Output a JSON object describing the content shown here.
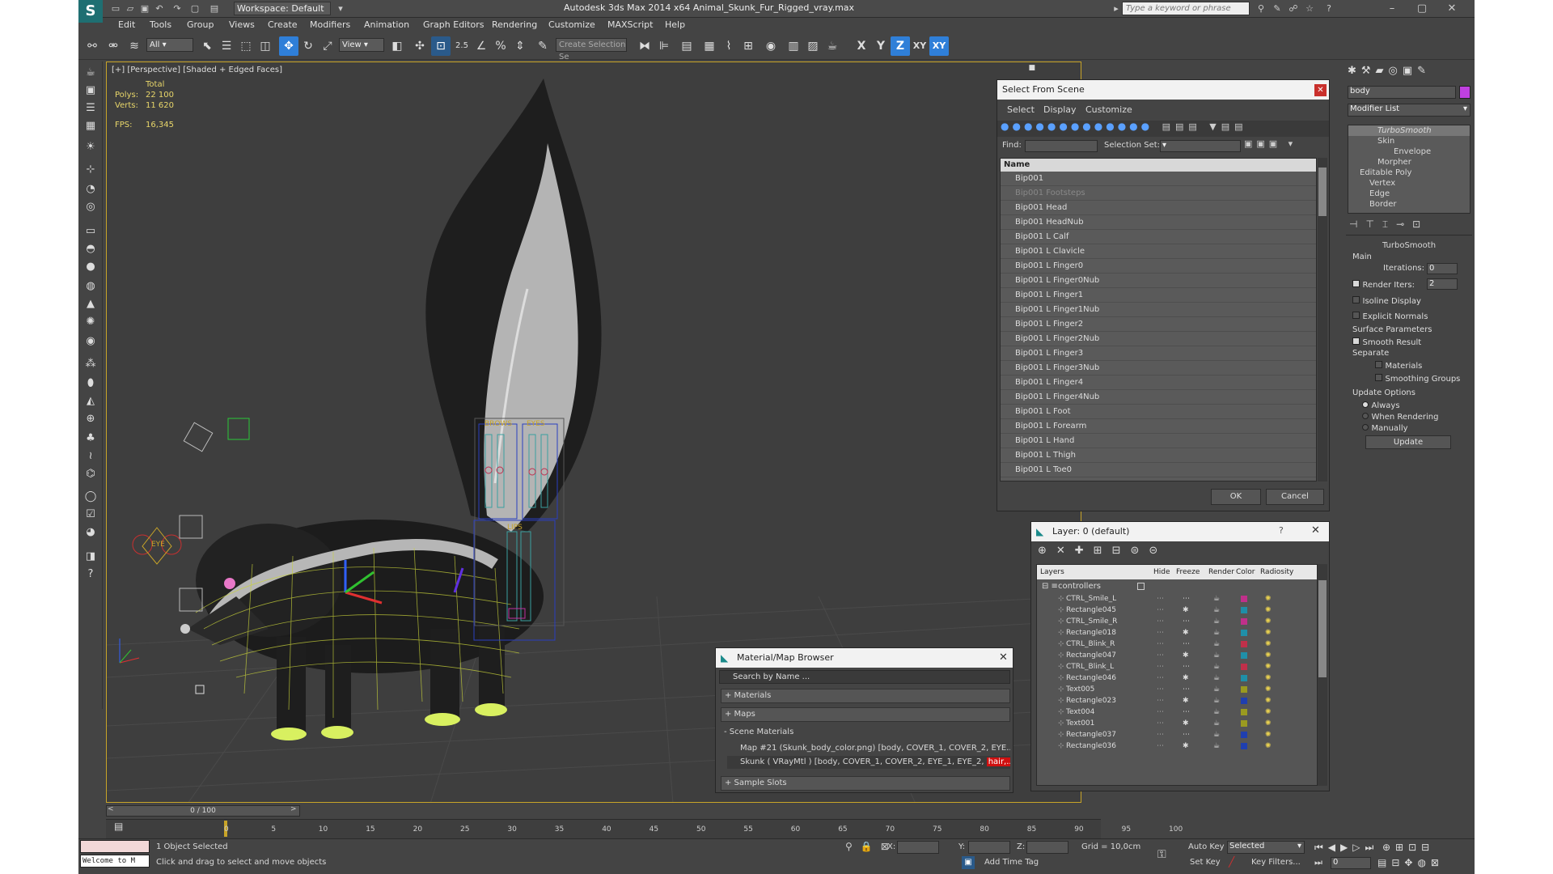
{
  "titlebar": {
    "workspace": "Workspace: Default",
    "app_title": "Autodesk 3ds Max  2014 x64     Animal_Skunk_Fur_Rigged_vray.max",
    "search_placeholder": "Type a keyword or phrase"
  },
  "menu": [
    "Edit",
    "Tools",
    "Group",
    "Views",
    "Create",
    "Modifiers",
    "Animation",
    "Graph Editors",
    "Rendering",
    "Customize",
    "MAXScript",
    "Help"
  ],
  "toolbar": {
    "filter": "All",
    "ref_coord": "View",
    "angle_snap": "2.5",
    "selection_set": "Create Selection Se",
    "axis": [
      "X",
      "Y",
      "Z",
      "XY",
      "XY"
    ]
  },
  "viewport": {
    "label": "[+] [Perspective] [Shaded + Edged Faces]",
    "stats": {
      "total_label": "Total",
      "polys_label": "Polys:",
      "polys": "22 100",
      "verts_label": "Verts:",
      "verts": "11 620",
      "fps_label": "FPS:",
      "fps": "16,345"
    },
    "rig_labels": {
      "brows": "BROWS",
      "eyes": "EYES",
      "lips": "LIPS",
      "eye": "EYE"
    }
  },
  "select_dialog": {
    "title": "Select From Scene",
    "menu": [
      "Select",
      "Display",
      "Customize"
    ],
    "find_label": "Find:",
    "selset_label": "Selection Set:",
    "column": "Name",
    "items": [
      "Bip001",
      "Bip001 Footsteps",
      "Bip001 Head",
      "Bip001 HeadNub",
      "Bip001 L Calf",
      "Bip001 L Clavicle",
      "Bip001 L Finger0",
      "Bip001 L Finger0Nub",
      "Bip001 L Finger1",
      "Bip001 L Finger1Nub",
      "Bip001 L Finger2",
      "Bip001 L Finger2Nub",
      "Bip001 L Finger3",
      "Bip001 L Finger3Nub",
      "Bip001 L Finger4",
      "Bip001 L Finger4Nub",
      "Bip001 L Foot",
      "Bip001 L Forearm",
      "Bip001 L Hand",
      "Bip001 L Thigh",
      "Bip001 L Toe0"
    ],
    "ok": "OK",
    "cancel": "Cancel"
  },
  "layer_dialog": {
    "title": "Layer: 0 (default)",
    "help": "?",
    "columns": [
      "Layers",
      "Hide",
      "Freeze",
      "Render",
      "Color",
      "Radiosity"
    ],
    "parent": "controllers",
    "rows": [
      {
        "name": "CTRL_Smile_L",
        "color": "#c0308a"
      },
      {
        "name": "Rectangle045",
        "color": "#1f8fa8"
      },
      {
        "name": "CTRL_Smile_R",
        "color": "#c0308a"
      },
      {
        "name": "Rectangle018",
        "color": "#1f8fa8"
      },
      {
        "name": "CTRL_Blink_R",
        "color": "#c0304a"
      },
      {
        "name": "Rectangle047",
        "color": "#1f8fa8"
      },
      {
        "name": "CTRL_Blink_L",
        "color": "#c0304a"
      },
      {
        "name": "Rectangle046",
        "color": "#1f8fa8"
      },
      {
        "name": "Text005",
        "color": "#9a9a20"
      },
      {
        "name": "Rectangle023",
        "color": "#1f3fb0"
      },
      {
        "name": "Text004",
        "color": "#9a9a20"
      },
      {
        "name": "Text001",
        "color": "#9a9a20"
      },
      {
        "name": "Rectangle037",
        "color": "#1f3fb0"
      },
      {
        "name": "Rectangle036",
        "color": "#1f3fb0"
      }
    ]
  },
  "material_browser": {
    "title": "Material/Map Browser",
    "search": "Search by Name ...",
    "sections": [
      "+ Materials",
      "+ Maps",
      "- Scene Materials"
    ],
    "map_item": "Map #21 (Skunk_body_color.png)  [body, COVER_1, COVER_2, EYE...",
    "mat_item": "Skunk  ( VRayMtl )  [body, COVER_1, COVER_2, EYE_1, EYE_2,",
    "mat_item_hl": "hair,...",
    "sample_slots": "+ Sample Slots"
  },
  "command_panel": {
    "object_name": "body",
    "modifier_list": "Modifier List",
    "stack": [
      "TurboSmooth",
      "Skin",
      "Envelope",
      "Morpher",
      "Editable Poly",
      "Vertex",
      "Edge",
      "Border"
    ],
    "rollout_title": "TurboSmooth",
    "main_label": "Main",
    "iterations_label": "Iterations:",
    "iterations": "0",
    "render_iters_label": "Render Iters:",
    "render_iters": "2",
    "isoline": "Isoline Display",
    "explicit_normals": "Explicit Normals",
    "surface_params": "Surface Parameters",
    "smooth_result": "Smooth Result",
    "separate": "Separate",
    "materials": "Materials",
    "smoothing_groups": "Smoothing Groups",
    "update_options": "Update Options",
    "always": "Always",
    "when_rendering": "When Rendering",
    "manually": "Manually",
    "update_btn": "Update"
  },
  "timeline": {
    "frame": "0 / 100",
    "ticks": [
      "0",
      "5",
      "10",
      "15",
      "20",
      "25",
      "30",
      "35",
      "40",
      "45",
      "50",
      "55",
      "60",
      "65",
      "70",
      "75",
      "80",
      "85",
      "90",
      "95",
      "100"
    ]
  },
  "status": {
    "maxscript": "Welcome to M",
    "selected": "1 Object Selected",
    "prompt": "Click and drag to select and move objects",
    "x_label": "X:",
    "y_label": "Y:",
    "z_label": "Z:",
    "grid": "Grid = 10,0cm",
    "auto_key": "Auto Key",
    "set_key": "Set Key",
    "selected_dd": "Selected",
    "key_filters": "Key Filters...",
    "add_time_tag": "Add Time Tag",
    "frame_field": "0"
  }
}
